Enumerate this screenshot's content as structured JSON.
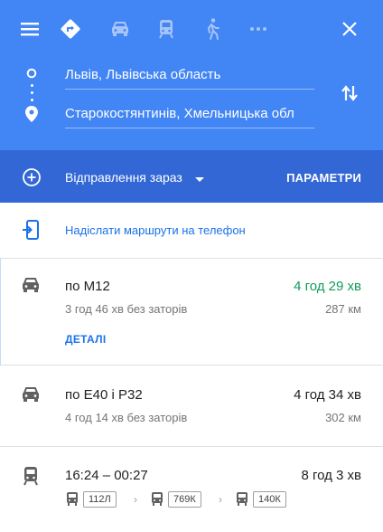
{
  "colors": {
    "header": "#4285f4",
    "departure_bar": "#3367d6",
    "accent": "#1a73e8",
    "fast_time": "#0f9d58"
  },
  "header": {
    "modes": [
      "menu-icon",
      "best-route-icon",
      "car-icon",
      "transit-icon",
      "walk-icon",
      "more-icon",
      "close-icon"
    ],
    "origin": "Львів, Львівська область",
    "destination": "Старокостянтинів, Хмельницька обл"
  },
  "departure": {
    "label": "Відправлення зараз",
    "options_label": "ПАРАМЕТРИ"
  },
  "send_to_phone": {
    "label": "Надіслати маршрути на телефон"
  },
  "routes": [
    {
      "mode": "car",
      "title": "по M12",
      "time": "4 год 29 хв",
      "subtitle": "3 год 46 хв без заторів",
      "distance": "287 км",
      "details_label": "ДЕТАЛІ"
    },
    {
      "mode": "car",
      "title": "по E40 і P32",
      "time": "4 год 34 хв",
      "subtitle": "4 год 14 хв без заторів",
      "distance": "302 км"
    },
    {
      "mode": "transit",
      "title": "16:24 – 00:27",
      "time": "8 год 3 хв",
      "legs": [
        "112Л",
        "769К",
        "140К"
      ]
    }
  ]
}
